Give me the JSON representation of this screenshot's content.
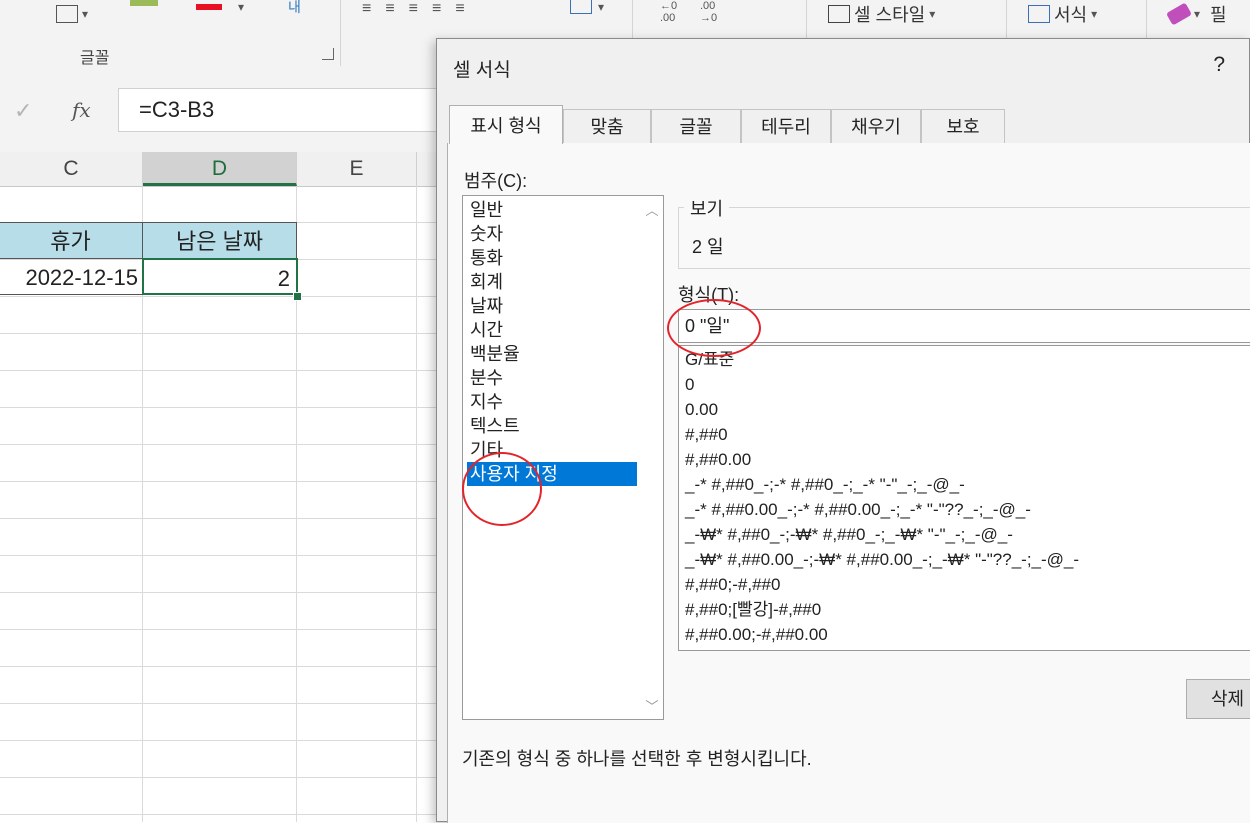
{
  "ribbon": {
    "font_group_label": "글꼴",
    "cell_styles_label": "셀 스타일",
    "format_label": "서식",
    "partial_label": "필",
    "decimal_increase": "←0\n.00",
    "decimal_decrease": ".00\n→0",
    "font_color": "#e81123"
  },
  "formula_bar": {
    "fx_label": "fx",
    "formula": "=C3-B3"
  },
  "sheet": {
    "columns": [
      "C",
      "D",
      "E"
    ],
    "header_cells": [
      "휴가",
      "남은 날짜"
    ],
    "value_cells": [
      "2022-12-15",
      "2"
    ],
    "header_fill": "#b7dde8",
    "accent": "#217346"
  },
  "dialog": {
    "title": "셀 서식",
    "help": "?",
    "tabs": [
      "표시 형식",
      "맞춤",
      "글꼴",
      "테두리",
      "채우기",
      "보호"
    ],
    "category_label": "범주(C):",
    "categories": [
      "일반",
      "숫자",
      "통화",
      "회계",
      "날짜",
      "시간",
      "백분율",
      "분수",
      "지수",
      "텍스트",
      "기타",
      "사용자 지정"
    ],
    "selected_category": "사용자 지정",
    "sample_label": "보기",
    "sample_value": "2 일",
    "format_label": "형식(T):",
    "format_value": "0 \"일\"",
    "format_list": [
      "G/표준",
      "0",
      "0.00",
      "#,##0",
      "#,##0.00",
      "_-* #,##0_-;-* #,##0_-;_-* \"-\"_-;_-@_-",
      "_-* #,##0.00_-;-* #,##0.00_-;_-* \"-\"??_-;_-@_-",
      "_-₩* #,##0_-;-₩* #,##0_-;_-₩* \"-\"_-;_-@_-",
      "_-₩* #,##0.00_-;-₩* #,##0.00_-;_-₩* \"-\"??_-;_-@_-",
      "#,##0;-#,##0",
      "#,##0;[빨강]-#,##0",
      "#,##0.00;-#,##0.00"
    ],
    "delete_label": "삭제",
    "description": "기존의 형식 중 하나를 선택한 후 변형시킵니다.",
    "selection_color": "#0078d7"
  },
  "annotations": {
    "color": "#e3242b"
  }
}
